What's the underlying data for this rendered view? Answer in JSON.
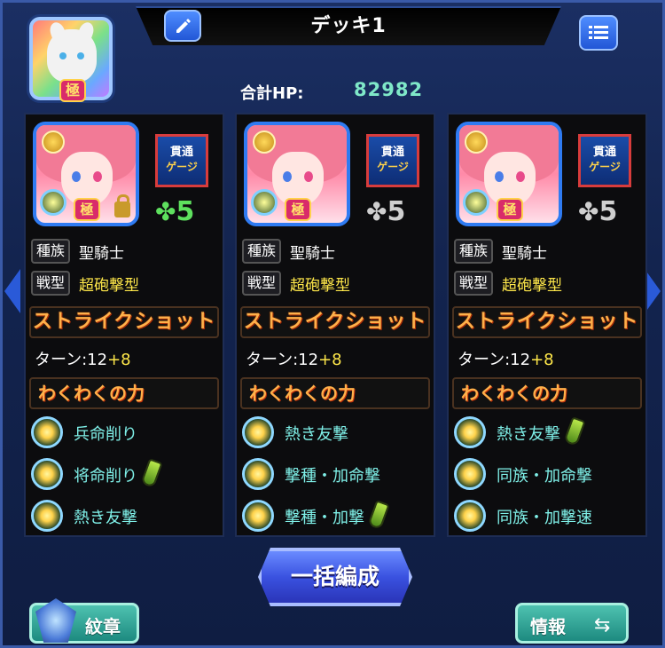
{
  "header": {
    "deck_title": "デッキ1",
    "hp_label": "合計HP:",
    "hp_value": "82982",
    "leader_rank": "極"
  },
  "labels": {
    "tribe": "種族",
    "type": "戦型",
    "strike_shot": "ストライクショット",
    "turn_prefix": "ターン:",
    "waku": "わくわくの力",
    "gauge_line1": "貫通",
    "gauge_line2": "ゲージ",
    "rank": "極"
  },
  "cards": [
    {
      "luck": "5",
      "luck_color": "#5ee05e",
      "locked": true,
      "tribe": "聖騎士",
      "type": "超砲撃型",
      "turn_base": "12",
      "turn_plus": "+8",
      "abilities": [
        {
          "text": "兵命削り",
          "potion": false
        },
        {
          "text": "将命削り",
          "potion": true
        },
        {
          "text": "熱き友撃",
          "potion": false
        }
      ]
    },
    {
      "luck": "5",
      "luck_color": "#cfcfcf",
      "locked": false,
      "tribe": "聖騎士",
      "type": "超砲撃型",
      "turn_base": "12",
      "turn_plus": "+8",
      "abilities": [
        {
          "text": "熱き友撃",
          "potion": false
        },
        {
          "text": "撃種・加命撃",
          "potion": false
        },
        {
          "text": "撃種・加撃",
          "potion": true
        }
      ]
    },
    {
      "luck": "5",
      "luck_color": "#cfcfcf",
      "locked": false,
      "tribe": "聖騎士",
      "type": "超砲撃型",
      "turn_base": "12",
      "turn_plus": "+8",
      "abilities": [
        {
          "text": "熱き友撃",
          "potion": true
        },
        {
          "text": "同族・加命撃",
          "potion": false
        },
        {
          "text": "同族・加撃速",
          "potion": false
        }
      ]
    }
  ],
  "buttons": {
    "bulk": "一括編成",
    "emblem": "紋章",
    "info": "情報",
    "info_icon": "⇆"
  },
  "colors": {
    "hp": "#7fe8c8",
    "ability": "#7ff0e8",
    "type": "#ffe84a",
    "strike": "#ffb04a"
  }
}
